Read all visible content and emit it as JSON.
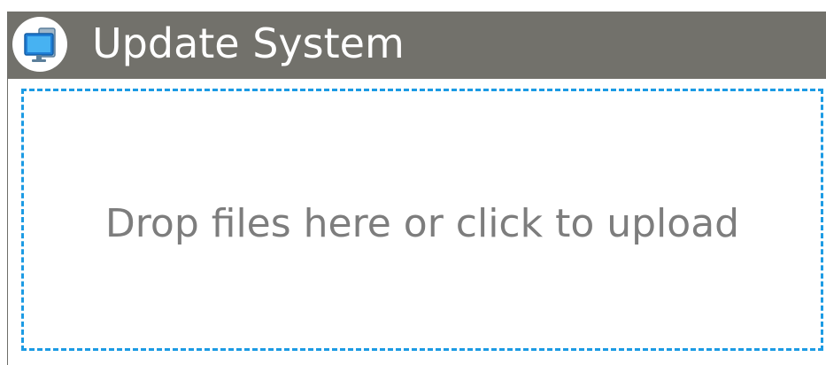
{
  "window": {
    "title": "Update System",
    "icon": "monitor-icon"
  },
  "dropzone": {
    "message": "Drop files here or click to upload"
  },
  "colors": {
    "titlebar": "#72716b",
    "title_text": "#ffffff",
    "dropzone_border": "#1c9be4",
    "dropzone_text": "#7d7d7d"
  }
}
